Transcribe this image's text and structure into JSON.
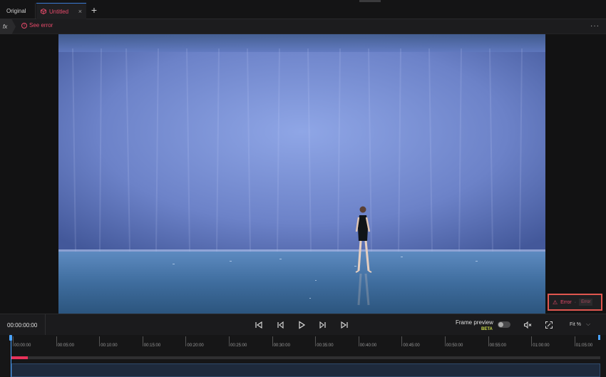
{
  "tabs": {
    "original": "Original",
    "untitled": "Untitled",
    "close_icon": "×",
    "add_icon": "+"
  },
  "toolbar": {
    "fx_label": "fx",
    "see_error": "See error",
    "more_icon": "···"
  },
  "viewer": {
    "error_label": "Error",
    "error_sub": "Error"
  },
  "controls": {
    "timecode": "00:00:00:00",
    "frame_preview": "Frame preview",
    "beta": "BETA",
    "fit": "Fit %"
  },
  "timeline": {
    "ticks": [
      "00:00:00",
      "00:05:00",
      "00:10:00",
      "00:15:00",
      "00:20:00",
      "00:25:00",
      "00:30:00",
      "00:35:00",
      "00:40:00",
      "00:45:00",
      "00:50:00",
      "00:55:00",
      "01:00:00",
      "01:05:00"
    ]
  },
  "colors": {
    "accent": "#e84a6a",
    "playhead": "#4aa3ff",
    "error_border": "#e0564f"
  }
}
